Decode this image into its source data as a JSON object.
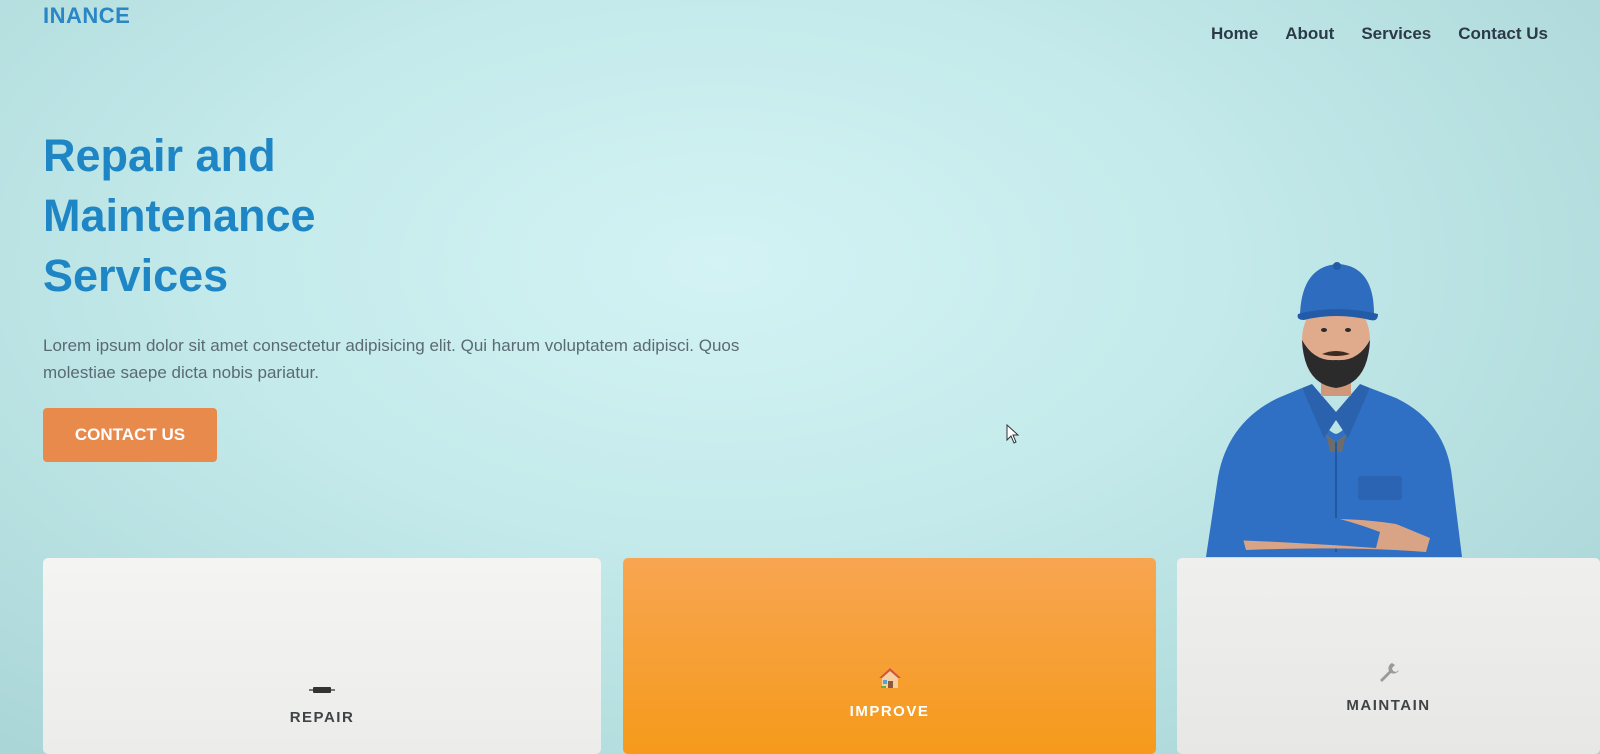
{
  "header": {
    "brand": "INANCE",
    "nav": [
      "Home",
      "About",
      "Services",
      "Contact Us"
    ]
  },
  "hero": {
    "title_line1": "Repair and",
    "title_line2": "Maintenance",
    "title_line3": "Services",
    "text": "Lorem ipsum dolor sit amet consectetur adipisicing elit. Qui harum voluptatem adipisci. Quos molestiae saepe dicta nobis pariatur.",
    "cta_label": "CONTACT US"
  },
  "cards": [
    {
      "label": "REPAIR",
      "icon": "repair-icon"
    },
    {
      "label": "IMPROVE",
      "icon": "house-icon"
    },
    {
      "label": "MAINTAIN",
      "icon": "wrench-icon"
    }
  ],
  "colors": {
    "brand": "#2a86c4",
    "hero_title": "#1f86c6",
    "cta": "#e88a4c",
    "highlight_card": "#f59a1a"
  }
}
